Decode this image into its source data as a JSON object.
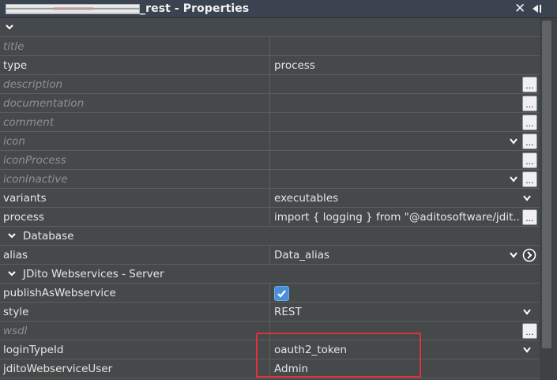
{
  "window": {
    "title": "_rest - Properties",
    "close_glyph": "✕",
    "icons": [
      "close-icon",
      "pin-icon"
    ]
  },
  "properties": {
    "title": {
      "label": "title",
      "value": ""
    },
    "type": {
      "label": "type",
      "value": "process"
    },
    "description": {
      "label": "description",
      "value": ""
    },
    "documentation": {
      "label": "documentation",
      "value": ""
    },
    "comment": {
      "label": "comment",
      "value": ""
    },
    "icon": {
      "label": "icon",
      "value": ""
    },
    "iconProcess": {
      "label": "iconProcess",
      "value": ""
    },
    "iconInactive": {
      "label": "iconInactive",
      "value": ""
    },
    "variants": {
      "label": "variants",
      "value": "executables"
    },
    "process": {
      "label": "process",
      "value": "import { logging } from \"@aditosoftware/jdit..."
    },
    "database_section": {
      "label": "Database",
      "expanded": true
    },
    "alias": {
      "label": "alias",
      "value": "Data_alias"
    },
    "webservices_section": {
      "label": "JDito Webservices - Server",
      "expanded": true
    },
    "publishAsWebservice": {
      "label": "publishAsWebservice",
      "checked": true
    },
    "style": {
      "label": "style",
      "value": "REST"
    },
    "wsdl": {
      "label": "wsdl",
      "value": ""
    },
    "loginTypeId": {
      "label": "loginTypeId",
      "value": "oauth2_token"
    },
    "jditoWebserviceUser": {
      "label": "jditoWebserviceUser",
      "value": "Admin"
    }
  },
  "buttons": {
    "ellipsis": "..."
  },
  "colors": {
    "background": "#3c3f41",
    "grid": "#45494a",
    "title_bar": "#3b4350",
    "checkbox": "#4a90d9",
    "highlight": "#e0303a",
    "unset_label": "#8e9193"
  }
}
